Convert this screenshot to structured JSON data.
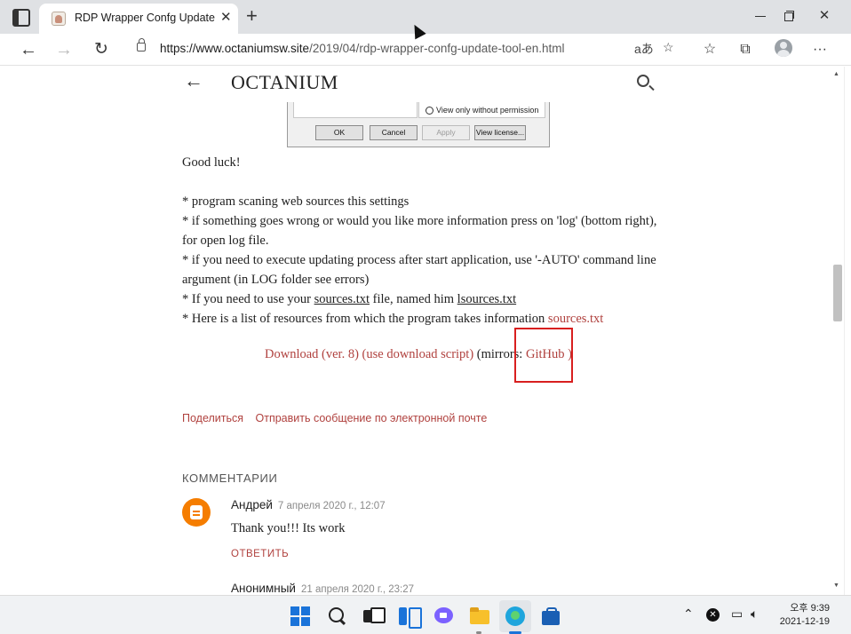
{
  "browser": {
    "tab_title": "RDP Wrapper Confg Update",
    "tab_close": "✕",
    "new_tab": "+",
    "url_host": "https://www.octaniumsw.site",
    "url_path": "/2019/04/rdp-wrapper-confg-update-tool-en.html"
  },
  "blog": {
    "title": "OCTANIUM"
  },
  "dialog": {
    "radio_label": "View only without permission",
    "buttons": [
      "OK",
      "Cancel",
      "Apply",
      "View license..."
    ]
  },
  "article": {
    "good_luck": "Good luck!",
    "line1": "* program scaning web sources this settings",
    "line2": "* if something goes wrong or would you like more information press on 'log' (bottom right), for open log file.",
    "line3": "* if you need to execute updating process after start application, use '-AUTO' command line argument (in LOG folder see errors)",
    "line4_a": "* If you need to use your ",
    "line4_link1": "sources.txt",
    "line4_b": " file, named him ",
    "line4_link2": "lsources.txt",
    "line5_a": "* Here is a list of resources from which the program takes information ",
    "line5_link": "sources.txt"
  },
  "downloads": {
    "download": "Download (ver. 8)",
    "script": "(use download script)",
    "mirrors_prefix": "(mirrors: ",
    "github": "GitHub",
    "mirrors_suffix": " )"
  },
  "share": {
    "share": "Поделиться",
    "email": "Отправить сообщение по электронной почте"
  },
  "comments": {
    "heading": "КОММЕНТАРИИ",
    "items": [
      {
        "author": "Андрей",
        "date": "7 апреля 2020 г., 12:07",
        "body": "Thank you!!! Its work",
        "reply": "ОТВЕТИТЬ"
      },
      {
        "author": "Анонимный",
        "date": "21 апреля 2020 г., 23:27"
      }
    ]
  },
  "taskbar": {
    "time": "오후 9:39",
    "date": "2021-12-19"
  },
  "colors": {
    "link": "#b0413e",
    "highlight": "#d81f1f",
    "blogger_orange": "#f57d00"
  }
}
